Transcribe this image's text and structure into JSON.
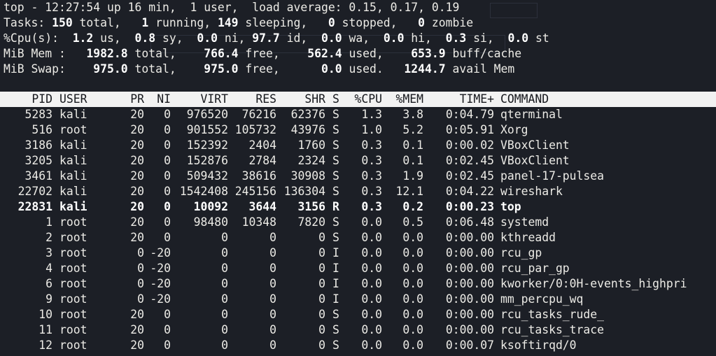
{
  "summary": {
    "top_prefix": "top - ",
    "time": "12:27:54",
    "uptime": " up 16 min,  1 user,  load average: 0.15, 0.17, 0.19",
    "tasks_label": "Tasks: ",
    "tasks_total": "150",
    "tasks_total_label": " total,   ",
    "tasks_running": "1",
    "tasks_running_label": " running, ",
    "tasks_sleeping": "149",
    "tasks_sleeping_label": " sleeping,   ",
    "tasks_stopped": "0",
    "tasks_stopped_label": " stopped,   ",
    "tasks_zombie": "0",
    "tasks_zombie_label": " zombie",
    "cpu_label": "%Cpu(s):  ",
    "cpu_us": "1.2",
    "cpu_us_label": " us,  ",
    "cpu_sy": "0.8",
    "cpu_sy_label": " sy,  ",
    "cpu_ni": "0.0",
    "cpu_ni_label": " ni, ",
    "cpu_id": "97.7",
    "cpu_id_label": " id,  ",
    "cpu_wa": "0.0",
    "cpu_wa_label": " wa,  ",
    "cpu_hi": "0.0",
    "cpu_hi_label": " hi,  ",
    "cpu_si": "0.3",
    "cpu_si_label": " si,  ",
    "cpu_st": "0.0",
    "cpu_st_label": " st",
    "mem_label": "MiB Mem :   ",
    "mem_total": "1982.8",
    "mem_total_label": " total,    ",
    "mem_free": "766.4",
    "mem_free_label": " free,    ",
    "mem_used": "562.4",
    "mem_used_label": " used,    ",
    "mem_buff": "653.9",
    "mem_buff_label": " buff/cache",
    "swap_label": "MiB Swap:    ",
    "swap_total": "975.0",
    "swap_total_label": " total,    ",
    "swap_free": "975.0",
    "swap_free_label": " free,      ",
    "swap_used": "0.0",
    "swap_used_label": " used.   ",
    "swap_avail": "1244.7",
    "swap_avail_label": " avail Mem"
  },
  "columns": {
    "pid": "PID",
    "user": "USER",
    "pr": "PR",
    "ni": "NI",
    "virt": "VIRT",
    "res": "RES",
    "shr": "SHR",
    "s": "S",
    "cpu": "%CPU",
    "mem": "%MEM",
    "time": "TIME+",
    "command": "COMMAND"
  },
  "processes": [
    {
      "pid": "5283",
      "user": "kali",
      "pr": "20",
      "ni": "0",
      "virt": "976520",
      "res": "76216",
      "shr": "62376",
      "s": "S",
      "cpu": "1.3",
      "mem": "3.8",
      "time": "0:04.79",
      "command": "qterminal",
      "bold": false
    },
    {
      "pid": "516",
      "user": "root",
      "pr": "20",
      "ni": "0",
      "virt": "901552",
      "res": "105732",
      "shr": "43976",
      "s": "S",
      "cpu": "1.0",
      "mem": "5.2",
      "time": "0:05.91",
      "command": "Xorg",
      "bold": false
    },
    {
      "pid": "3186",
      "user": "kali",
      "pr": "20",
      "ni": "0",
      "virt": "152392",
      "res": "2404",
      "shr": "1760",
      "s": "S",
      "cpu": "0.3",
      "mem": "0.1",
      "time": "0:00.02",
      "command": "VBoxClient",
      "bold": false
    },
    {
      "pid": "3205",
      "user": "kali",
      "pr": "20",
      "ni": "0",
      "virt": "152876",
      "res": "2784",
      "shr": "2324",
      "s": "S",
      "cpu": "0.3",
      "mem": "0.1",
      "time": "0:02.45",
      "command": "VBoxClient",
      "bold": false
    },
    {
      "pid": "3461",
      "user": "kali",
      "pr": "20",
      "ni": "0",
      "virt": "509432",
      "res": "38616",
      "shr": "30908",
      "s": "S",
      "cpu": "0.3",
      "mem": "1.9",
      "time": "0:02.45",
      "command": "panel-17-pulsea",
      "bold": false
    },
    {
      "pid": "22702",
      "user": "kali",
      "pr": "20",
      "ni": "0",
      "virt": "1542408",
      "res": "245156",
      "shr": "136304",
      "s": "S",
      "cpu": "0.3",
      "mem": "12.1",
      "time": "0:04.22",
      "command": "wireshark",
      "bold": false
    },
    {
      "pid": "22831",
      "user": "kali",
      "pr": "20",
      "ni": "0",
      "virt": "10092",
      "res": "3644",
      "shr": "3156",
      "s": "R",
      "cpu": "0.3",
      "mem": "0.2",
      "time": "0:00.23",
      "command": "top",
      "bold": true
    },
    {
      "pid": "1",
      "user": "root",
      "pr": "20",
      "ni": "0",
      "virt": "98480",
      "res": "10348",
      "shr": "7820",
      "s": "S",
      "cpu": "0.0",
      "mem": "0.5",
      "time": "0:06.48",
      "command": "systemd",
      "bold": false
    },
    {
      "pid": "2",
      "user": "root",
      "pr": "20",
      "ni": "0",
      "virt": "0",
      "res": "0",
      "shr": "0",
      "s": "S",
      "cpu": "0.0",
      "mem": "0.0",
      "time": "0:00.00",
      "command": "kthreadd",
      "bold": false
    },
    {
      "pid": "3",
      "user": "root",
      "pr": "0",
      "ni": "-20",
      "virt": "0",
      "res": "0",
      "shr": "0",
      "s": "I",
      "cpu": "0.0",
      "mem": "0.0",
      "time": "0:00.00",
      "command": "rcu_gp",
      "bold": false
    },
    {
      "pid": "4",
      "user": "root",
      "pr": "0",
      "ni": "-20",
      "virt": "0",
      "res": "0",
      "shr": "0",
      "s": "I",
      "cpu": "0.0",
      "mem": "0.0",
      "time": "0:00.00",
      "command": "rcu_par_gp",
      "bold": false
    },
    {
      "pid": "6",
      "user": "root",
      "pr": "0",
      "ni": "-20",
      "virt": "0",
      "res": "0",
      "shr": "0",
      "s": "I",
      "cpu": "0.0",
      "mem": "0.0",
      "time": "0:00.00",
      "command": "kworker/0:0H-events_highpri",
      "bold": false
    },
    {
      "pid": "9",
      "user": "root",
      "pr": "0",
      "ni": "-20",
      "virt": "0",
      "res": "0",
      "shr": "0",
      "s": "I",
      "cpu": "0.0",
      "mem": "0.0",
      "time": "0:00.00",
      "command": "mm_percpu_wq",
      "bold": false
    },
    {
      "pid": "10",
      "user": "root",
      "pr": "20",
      "ni": "0",
      "virt": "0",
      "res": "0",
      "shr": "0",
      "s": "S",
      "cpu": "0.0",
      "mem": "0.0",
      "time": "0:00.00",
      "command": "rcu_tasks_rude_",
      "bold": false
    },
    {
      "pid": "11",
      "user": "root",
      "pr": "20",
      "ni": "0",
      "virt": "0",
      "res": "0",
      "shr": "0",
      "s": "S",
      "cpu": "0.0",
      "mem": "0.0",
      "time": "0:00.00",
      "command": "rcu_tasks_trace",
      "bold": false
    },
    {
      "pid": "12",
      "user": "root",
      "pr": "20",
      "ni": "0",
      "virt": "0",
      "res": "0",
      "shr": "0",
      "s": "S",
      "cpu": "0.0",
      "mem": "0.0",
      "time": "0:00.07",
      "command": "ksoftirqd/0",
      "bold": false
    }
  ]
}
